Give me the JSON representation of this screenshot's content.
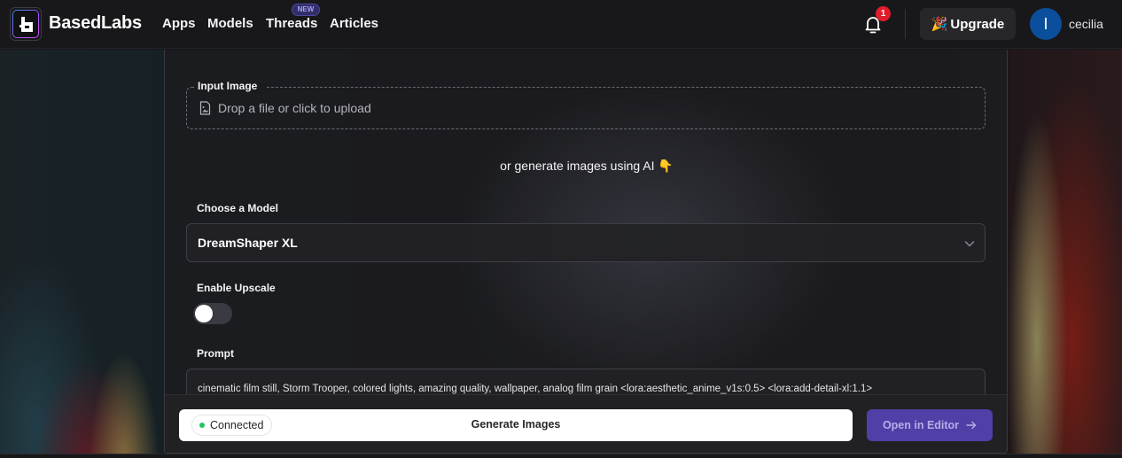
{
  "header": {
    "brand": "BasedLabs",
    "nav": [
      {
        "label": "Apps"
      },
      {
        "label": "Models"
      },
      {
        "label": "Threads",
        "badge": "NEW"
      },
      {
        "label": "Articles"
      }
    ],
    "notifications_count": "1",
    "upgrade": {
      "emoji": "🎉",
      "label": "Upgrade"
    },
    "user": {
      "initial": "I",
      "name": "cecilia",
      "avatar_color": "#0b4f9c"
    }
  },
  "form": {
    "input_image": {
      "label": "Input Image",
      "placeholder": "Drop a file or click to upload"
    },
    "or_text": "or generate images using AI",
    "or_emoji": "👇",
    "model": {
      "label": "Choose a Model",
      "value": "DreamShaper XL"
    },
    "upscale": {
      "label": "Enable Upscale",
      "enabled": false
    },
    "prompt": {
      "label": "Prompt",
      "value": "cinematic film still, Storm Trooper, colored lights, amazing quality, wallpaper, analog film grain <lora:aesthetic_anime_v1s:0.5>  <lora:add-detail-xl:1.1>"
    }
  },
  "footer": {
    "status": "Connected",
    "status_color": "#22c55e",
    "generate_label": "Generate Images",
    "editor_label": "Open in Editor",
    "editor_color": "#4f3fa6"
  }
}
